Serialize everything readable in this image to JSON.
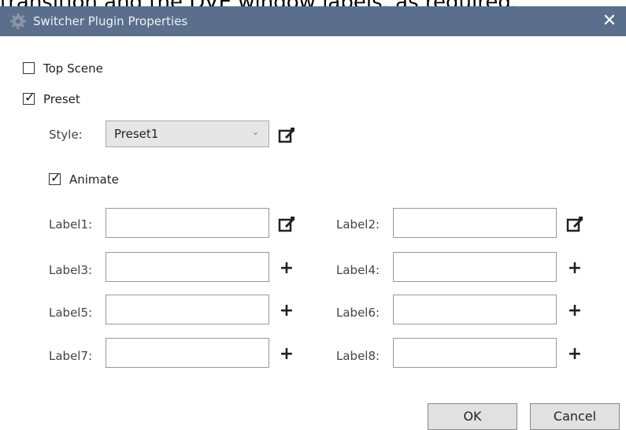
{
  "doc_text": "transition and the DVE window labels, as required.",
  "dialog": {
    "title": "Switcher Plugin Properties",
    "close_glyph": "✕"
  },
  "options": {
    "top_scene": {
      "label": "Top Scene",
      "checked": false
    },
    "preset": {
      "label": "Preset",
      "checked": true
    },
    "style": {
      "label": "Style:",
      "value": "Preset1"
    },
    "animate": {
      "label": "Animate",
      "checked": true
    }
  },
  "labels": [
    {
      "label": "Label1:",
      "value": "",
      "action": "edit-icon"
    },
    {
      "label": "Label2:",
      "value": "",
      "action": "edit-icon"
    },
    {
      "label": "Label3:",
      "value": "",
      "action": "plus-icon"
    },
    {
      "label": "Label4:",
      "value": "",
      "action": "plus-icon"
    },
    {
      "label": "Label5:",
      "value": "",
      "action": "plus-icon"
    },
    {
      "label": "Label6:",
      "value": "",
      "action": "plus-icon"
    },
    {
      "label": "Label7:",
      "value": "",
      "action": "plus-icon"
    },
    {
      "label": "Label8:",
      "value": "",
      "action": "plus-icon"
    }
  ],
  "plus_glyph": "+",
  "check_glyph": "✓",
  "chevron_glyph": "⌄",
  "buttons": {
    "ok": "OK",
    "cancel": "Cancel"
  },
  "colors": {
    "titlebar": "#5b6f8c"
  }
}
